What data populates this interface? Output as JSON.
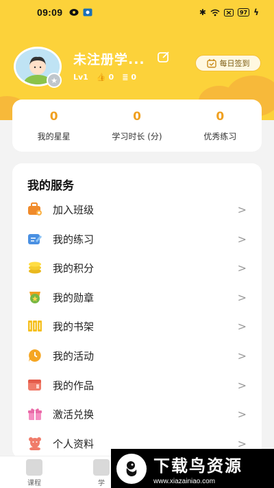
{
  "status_bar": {
    "time": "09:09",
    "battery": "97"
  },
  "profile": {
    "username": "未注册学...",
    "level": "Lv1",
    "likes": "0",
    "comments": "0",
    "checkin_label": "每日签到"
  },
  "stats": [
    {
      "value": "0",
      "label": "我的星星"
    },
    {
      "value": "0",
      "label": "学习时长 (分)"
    },
    {
      "value": "0",
      "label": "优秀练习"
    }
  ],
  "services": {
    "title": "我的服务",
    "items": [
      {
        "label": "加入班级",
        "icon": "briefcase-icon"
      },
      {
        "label": "我的练习",
        "icon": "pencil-icon"
      },
      {
        "label": "我的积分",
        "icon": "coins-icon"
      },
      {
        "label": "我的勋章",
        "icon": "medal-icon"
      },
      {
        "label": "我的书架",
        "icon": "bookshelf-icon"
      },
      {
        "label": "我的活动",
        "icon": "activity-icon"
      },
      {
        "label": "我的作品",
        "icon": "works-icon"
      },
      {
        "label": "激活兑换",
        "icon": "gift-icon"
      },
      {
        "label": "个人资料",
        "icon": "bear-icon"
      }
    ]
  },
  "tabbar": {
    "tab1": "课程",
    "tab2": "学"
  },
  "watermark": {
    "title": "下载鸟资源",
    "url": "www.xiazainiao.com"
  },
  "colors": {
    "header": "#fcd23a",
    "accent": "#f0a020",
    "cloud": "#f7b93a"
  }
}
